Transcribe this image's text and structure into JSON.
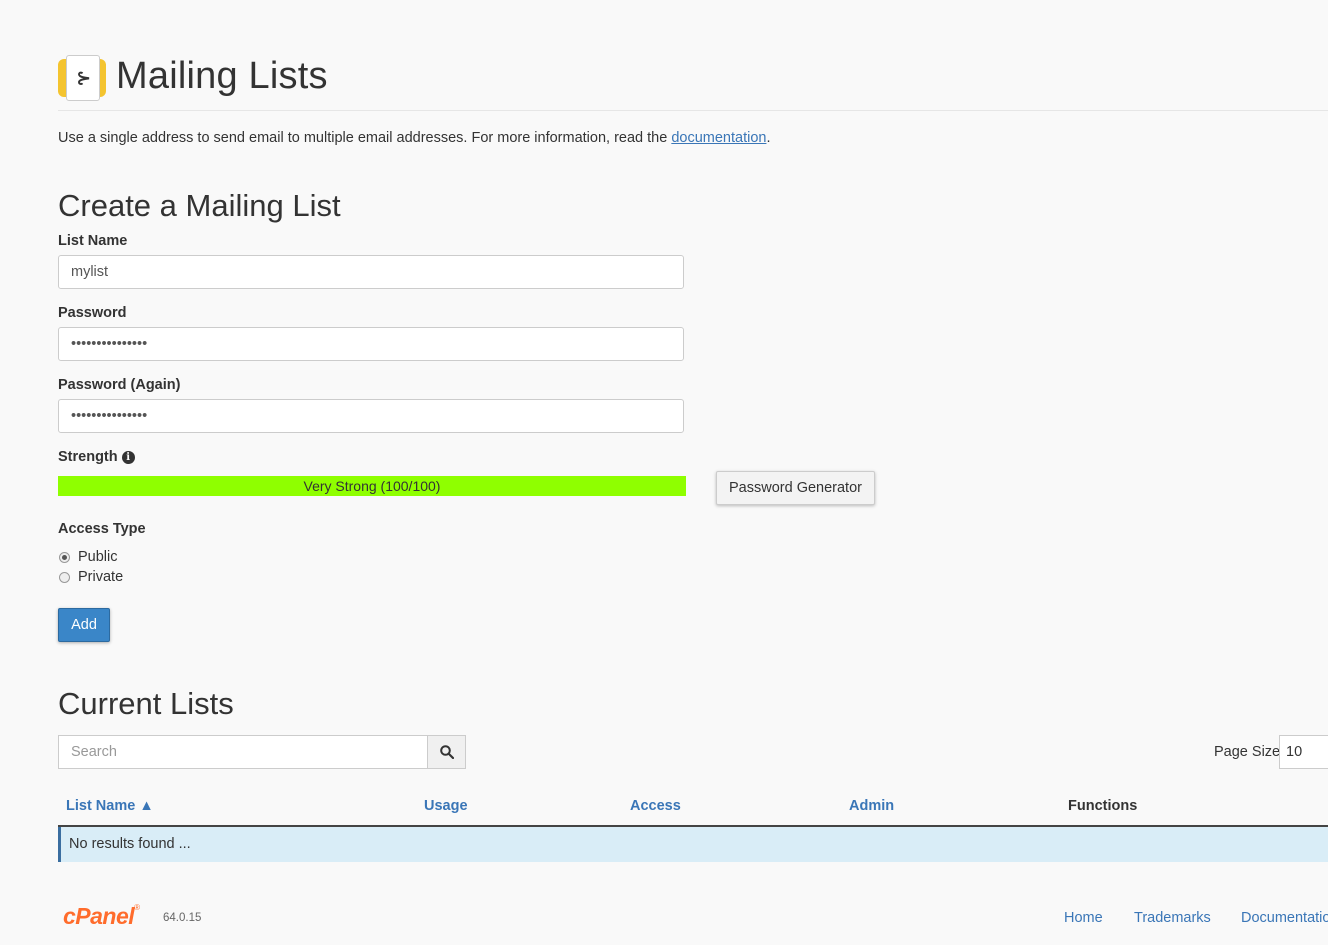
{
  "header": {
    "title": "Mailing Lists",
    "icon": "mailing-list-icon"
  },
  "intro": {
    "text": "Use a single address to send email to multiple email addresses. For more information, read the ",
    "link": "documentation",
    "suffix": "."
  },
  "create": {
    "heading": "Create a Mailing List",
    "list_name_label": "List Name",
    "list_name_value": "mylist",
    "password_label": "Password",
    "password_value": "•••••••••••••••",
    "password_again_label": "Password (Again)",
    "password_again_value": "•••••••••••••••",
    "strength_label": "Strength",
    "strength_text": "Very Strong (100/100)",
    "strength_percent": 100,
    "strength_color": "#8fff00",
    "generator_label": "Password Generator",
    "access_label": "Access Type",
    "access_options": [
      "Public",
      "Private"
    ],
    "access_selected": "Public",
    "add_label": "Add"
  },
  "current": {
    "heading": "Current Lists",
    "search_placeholder": "Search",
    "page_size_label": "Page Size",
    "page_size_value": "10",
    "columns": [
      "List Name ▲",
      "Usage",
      "Access",
      "Admin",
      "Functions"
    ],
    "empty_text": "No results found ..."
  },
  "footer": {
    "logo": "cPanel",
    "version": "64.0.15",
    "links": [
      "Home",
      "Trademarks",
      "Documentation"
    ]
  },
  "colors": {
    "accent": "#3a76b7",
    "primary_button": "#3a86c8",
    "empty_row_bg": "#d9edf7",
    "logo": "#ff6c2c"
  }
}
